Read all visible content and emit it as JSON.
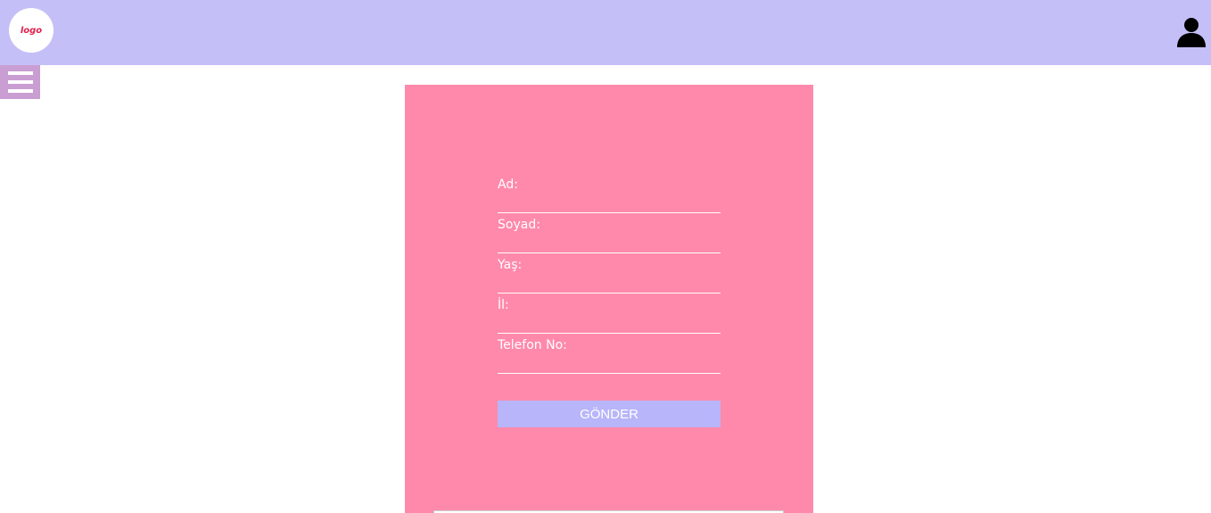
{
  "header": {
    "logo_text": "logo",
    "brand_color": "#e0204d",
    "background": "#c5bff8",
    "user_icon": "user-icon"
  },
  "menu": {
    "icon": "hamburger-menu-icon"
  },
  "form": {
    "fields": [
      {
        "label": "Ad:",
        "value": ""
      },
      {
        "label": "Soyad:",
        "value": ""
      },
      {
        "label": "Yaş:",
        "value": ""
      },
      {
        "label": "İl:",
        "value": ""
      },
      {
        "label": "Telefon No:",
        "value": ""
      }
    ],
    "submit_label": "GÖNDER",
    "panel_color": "#ff89ab",
    "button_color": "#b8b5fa"
  }
}
